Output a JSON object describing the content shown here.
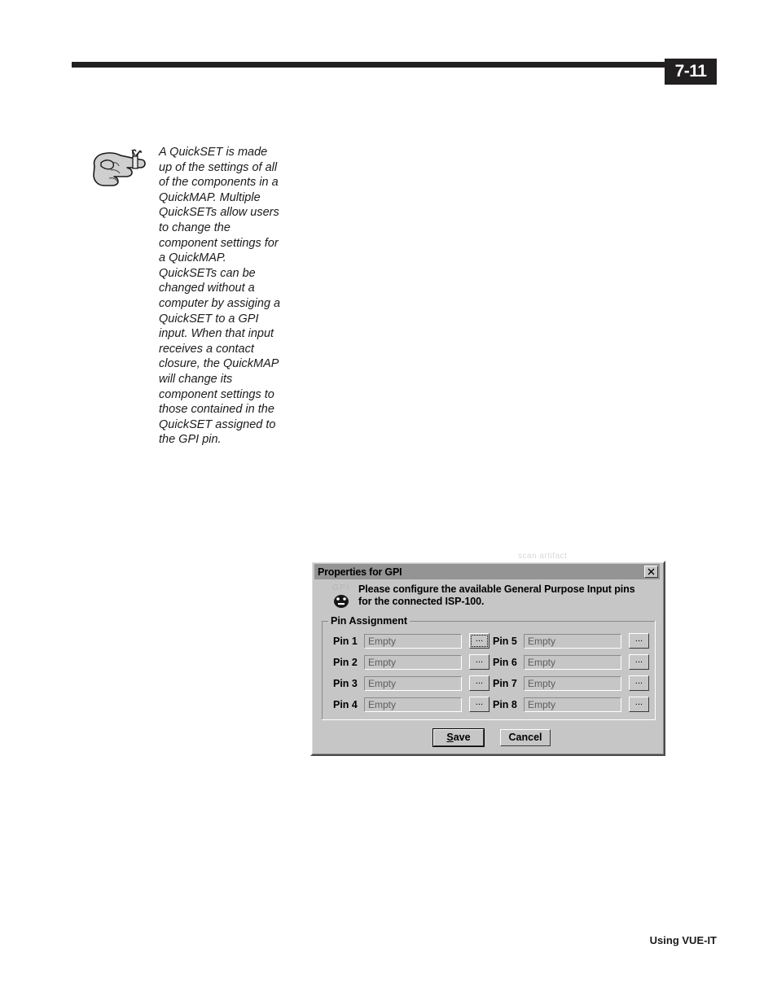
{
  "page": {
    "number": "7-11",
    "footer": "Using VUE-IT"
  },
  "note": {
    "icon": "pointing-hand-with-string-icon",
    "text": "A QuickSET is made up of the settings of all of the components in a QuickMAP. Multiple QuickSETs allow users to change the component settings for a QuickMAP. QuickSETs can be changed without a computer by assiging a QuickSET to a GPI input. When that input receives a contact closure, the QuickMAP will change its component settings to those contained in the QuickSET assigned to the GPI pin."
  },
  "artifact": {
    "ghost_text": "scan artifact"
  },
  "dialog": {
    "title": "Properties for GPI",
    "close_label": "×",
    "device_badge_label": "GPI",
    "instruction": "Please configure the available General Purpose Input pins for the connected ISP-100.",
    "group_title": "Pin Assignment",
    "browse_label": "...",
    "field_placeholder": "Empty",
    "pins_left": [
      {
        "label": "Pin 1",
        "value": "Empty",
        "focused": true
      },
      {
        "label": "Pin 2",
        "value": "Empty",
        "focused": false
      },
      {
        "label": "Pin 3",
        "value": "Empty",
        "focused": false
      },
      {
        "label": "Pin 4",
        "value": "Empty",
        "focused": false
      }
    ],
    "pins_right": [
      {
        "label": "Pin 5",
        "value": "Empty",
        "focused": false
      },
      {
        "label": "Pin 6",
        "value": "Empty",
        "focused": false
      },
      {
        "label": "Pin 7",
        "value": "Empty",
        "focused": false
      },
      {
        "label": "Pin 8",
        "value": "Empty",
        "focused": false
      }
    ],
    "save_accel": "S",
    "save_rest": "ave",
    "cancel_label": "Cancel"
  },
  "colors": {
    "page_number_bg": "#211f1f",
    "dialog_face": "#c6c6c6",
    "titlebar_bg": "#949494",
    "field_text": "#5d5d5d"
  }
}
